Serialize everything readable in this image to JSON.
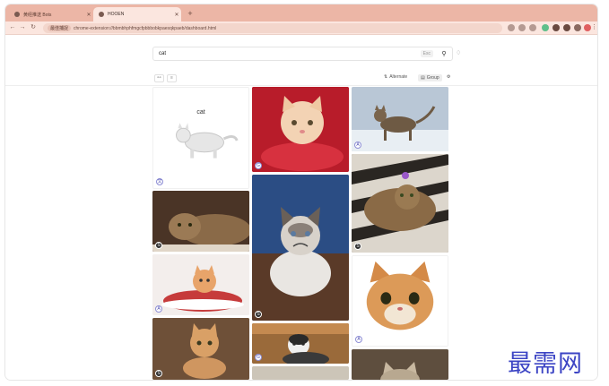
{
  "browser": {
    "tabs": [
      {
        "title": "黄经推送 Bots",
        "active": false
      },
      {
        "title": "HOOEN",
        "active": true
      }
    ],
    "address_chip": "最佳捕捉",
    "url": "chrome-extension://bbmbhphfmgcfpbbbobkpaesqkpaeb/dashboard.html"
  },
  "search": {
    "query": "cat",
    "esc_label": "Esc"
  },
  "toolbar": {
    "alternate_label": "Alternate",
    "group_label": "Group"
  },
  "cards": [
    {
      "label": "cat",
      "badge": "文",
      "badge_style": "light"
    },
    {
      "badge": "G",
      "badge_style": "light"
    },
    {
      "badge": "A",
      "badge_style": "light"
    },
    {
      "badge": "G",
      "badge_style": "light"
    },
    {
      "badge": "S",
      "badge_style": "dark"
    },
    {
      "badge": "S",
      "badge_style": "dark"
    },
    {
      "badge": "A",
      "badge_style": "light"
    },
    {
      "badge": "S",
      "badge_style": "dark"
    },
    {
      "badge": "A",
      "badge_style": "light"
    },
    {
      "badge": "S",
      "badge_style": "dark"
    },
    {
      "badge": "G",
      "badge_style": "light"
    },
    {
      "badge": "",
      "badge_style": "none"
    }
  ],
  "colors": {
    "tab_strip": "#ecb6a6",
    "toolbar": "#fbe6df",
    "watermark": "#3c44c4"
  },
  "watermark": "最需网"
}
